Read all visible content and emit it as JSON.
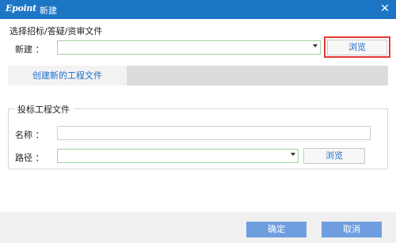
{
  "window": {
    "logo": "Epoint",
    "title": "新建",
    "close_icon": "close-icon"
  },
  "select_section": {
    "title": "选择招标/答疑/资审文件",
    "new_label": "新建 ：",
    "new_value": "",
    "browse_label": "浏览"
  },
  "tab": {
    "label": "创建新的工程文件"
  },
  "bid_group": {
    "title": "投标工程文件",
    "name_label": "名称 ：",
    "name_value": "",
    "path_label": "路径 ：",
    "path_value": "",
    "browse_label": "浏览"
  },
  "footer": {
    "ok_label": "确定",
    "cancel_label": "取消"
  },
  "colors": {
    "titlebar": "#1d76c4",
    "link_text": "#1d6fc9",
    "highlight": "#e53935",
    "primary_button": "#6f9ee0"
  }
}
